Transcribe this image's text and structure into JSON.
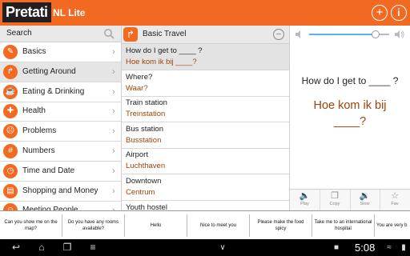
{
  "app": {
    "logo": "Pretati",
    "title": "NL Lite"
  },
  "colors": {
    "accent": "#f26a21",
    "translation": "#a0430a"
  },
  "search": {
    "label": "Search"
  },
  "categories": [
    {
      "label": "Basics",
      "icon": "basics-icon"
    },
    {
      "label": "Getting Around",
      "icon": "getting-around-icon",
      "selected": true
    },
    {
      "label": "Eating & Drinking",
      "icon": "eating-drinking-icon"
    },
    {
      "label": "Health",
      "icon": "health-icon"
    },
    {
      "label": "Problems",
      "icon": "problems-icon"
    },
    {
      "label": "Numbers",
      "icon": "numbers-icon"
    },
    {
      "label": "Time and Date",
      "icon": "time-date-icon"
    },
    {
      "label": "Shopping and Money",
      "icon": "shopping-money-icon"
    },
    {
      "label": "Meeting People",
      "icon": "meeting-people-icon"
    }
  ],
  "section": {
    "title": "Basic Travel"
  },
  "phrases": [
    {
      "en": "How do I get to ____ ?",
      "nl": "Hoe kom ik bij ____?",
      "selected": true
    },
    {
      "en": "Where?",
      "nl": "Waar?"
    },
    {
      "en": "Train station",
      "nl": "Treinstation"
    },
    {
      "en": "Bus station",
      "nl": "Busstation"
    },
    {
      "en": "Airport",
      "nl": "Luchthaven"
    },
    {
      "en": "Downtown",
      "nl": "Centrum"
    },
    {
      "en": "Youth hostel",
      "nl": ""
    }
  ],
  "detail": {
    "source": "How do I get to ____ ?",
    "target": "Hoe kom ik bij ____?"
  },
  "volume": {
    "level": 0.86
  },
  "actions": [
    {
      "label": "Play",
      "icon": "play-icon"
    },
    {
      "label": "Copy",
      "icon": "copy-icon"
    },
    {
      "label": "Slow",
      "icon": "slow-icon"
    },
    {
      "label": "Fav",
      "icon": "star-icon"
    }
  ],
  "quick_phrases": [
    "Can you show me on the map?",
    "Do you have any rooms available?",
    "Hello",
    "Nice to meet you",
    "Please make the food spicy",
    "Take me to an international hospital",
    "You are very b"
  ],
  "system": {
    "time": "5:08"
  }
}
